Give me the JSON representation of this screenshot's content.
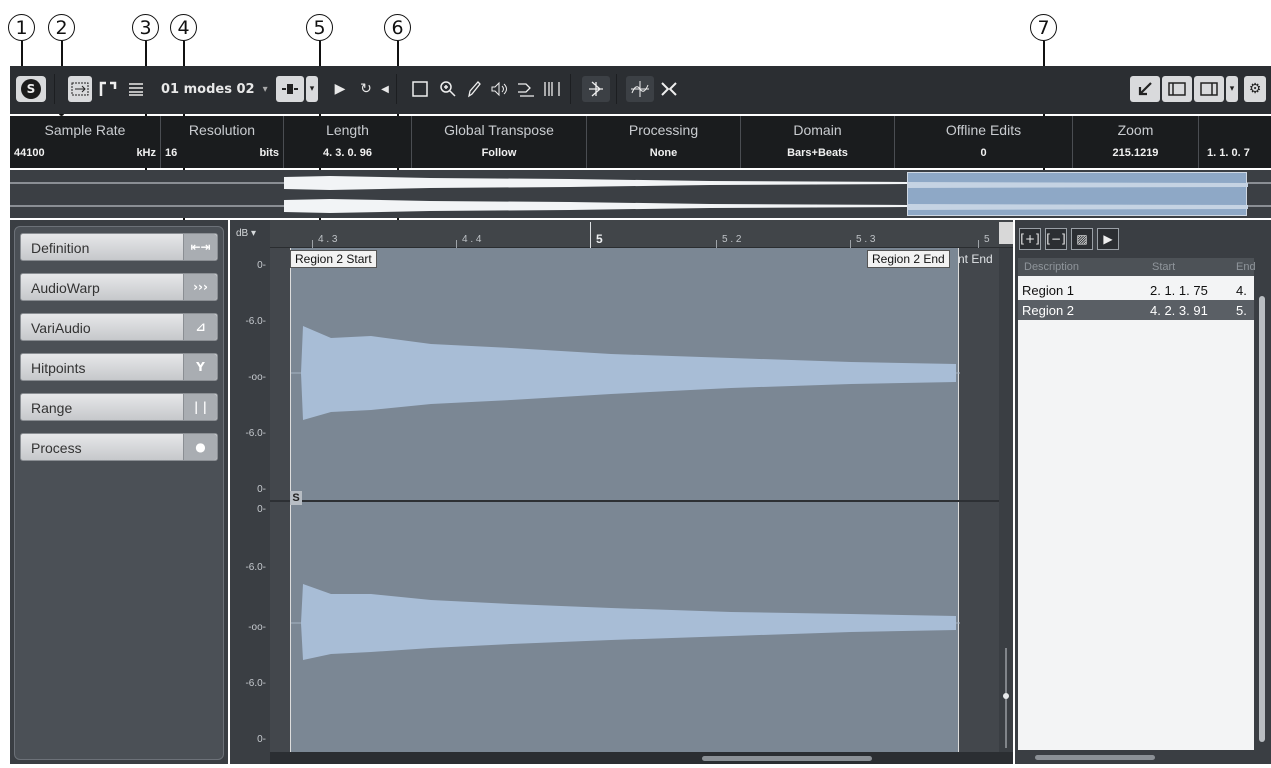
{
  "callouts": [
    "1",
    "2",
    "3",
    "4",
    "5",
    "6",
    "7"
  ],
  "toolbar": {
    "solo_icon": "S",
    "preset_name": "01 modes 02",
    "preset_chevron": "▾",
    "play_icon": "▶",
    "loop_icon": "↻",
    "icons": [
      "autoscroll-icon",
      "snap-icon",
      "stack-icon",
      "selection-icon",
      "zoom-icon",
      "pencil-icon",
      "speaker-icon",
      "warp-icon",
      "hitpoint-icon",
      "gear-icon"
    ]
  },
  "info_line": [
    {
      "label": "Sample Rate",
      "value": "44100",
      "unit": "kHz"
    },
    {
      "label": "Resolution",
      "value": "16",
      "unit": "bits"
    },
    {
      "label": "Length",
      "value": "4. 3. 0. 96"
    },
    {
      "label": "Global Transpose",
      "value": "Follow"
    },
    {
      "label": "Processing",
      "value": "None"
    },
    {
      "label": "Domain",
      "value": "Bars+Beats"
    },
    {
      "label": "Offline Edits",
      "value": "0"
    },
    {
      "label": "Zoom",
      "value": "215.1219"
    },
    {
      "label": "",
      "value": "1. 1. 0. 7"
    }
  ],
  "left_panel": {
    "sections": [
      {
        "label": "Definition",
        "icon": "definition-icon"
      },
      {
        "label": "AudioWarp",
        "icon": "audiowarp-icon"
      },
      {
        "label": "VariAudio",
        "icon": "variaudio-icon"
      },
      {
        "label": "Hitpoints",
        "icon": "hitpoints-icon"
      },
      {
        "label": "Range",
        "icon": "range-icon"
      },
      {
        "label": "Process",
        "icon": "process-icon"
      }
    ]
  },
  "ruler": {
    "ticks": [
      "4 . 3",
      "4 . 4",
      "5",
      "5 . 2",
      "5 . 3",
      "5"
    ]
  },
  "db_scale": {
    "header": "dB ▾",
    "labels": [
      "0-",
      "-6.0-",
      "-oo-",
      "-6.0-",
      "0-",
      "0-",
      "-6.0-",
      "-oo-",
      "-6.0-",
      "0-"
    ]
  },
  "editor": {
    "region_start_label": "Region 2 Start",
    "region_end_label": "Region 2 End",
    "end_label_cut": "nt End",
    "sustain_marker": "S"
  },
  "regions": {
    "columns": [
      "Description",
      "Start",
      "End"
    ],
    "rows": [
      {
        "description": "Region 1",
        "start": "2. 1. 1. 75",
        "end": "4.",
        "selected": false
      },
      {
        "description": "Region 2",
        "start": "4. 2. 3. 91",
        "end": "5.",
        "selected": true
      }
    ],
    "buttons": [
      "add-region-icon",
      "remove-region-icon",
      "event-from-region-icon",
      "play-region-icon"
    ]
  },
  "colors": {
    "toolbar_bg": "#2b2e32",
    "waveform": "#a8bdd6",
    "region_bg": "#7b8794",
    "selected_row": "#5a5f65"
  }
}
